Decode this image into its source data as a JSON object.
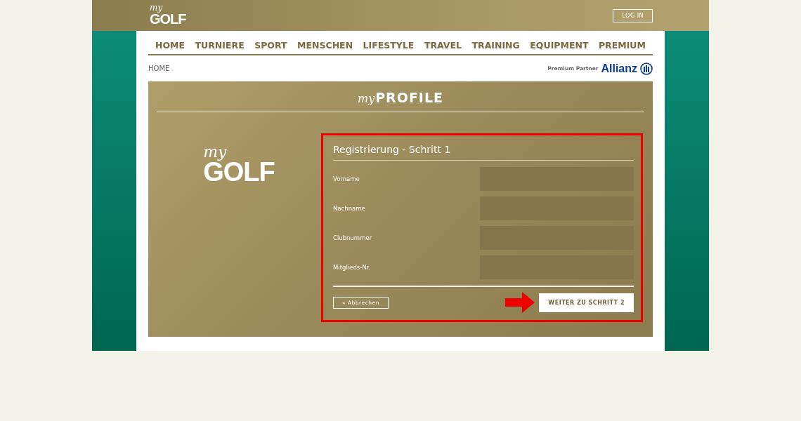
{
  "header": {
    "logo": {
      "script": "my",
      "word": "GOLF"
    },
    "login_button": "LOG IN"
  },
  "nav": {
    "items": [
      {
        "label": "HOME"
      },
      {
        "label": "TURNIERE"
      },
      {
        "label": "SPORT"
      },
      {
        "label": "MENSCHEN"
      },
      {
        "label": "LIFESTYLE"
      },
      {
        "label": "TRAVEL"
      },
      {
        "label": "TRAINING"
      },
      {
        "label": "EQUIPMENT"
      },
      {
        "label": "PREMIUM"
      }
    ]
  },
  "breadcrumb": "HOME",
  "partner": {
    "label": "Premium Partner",
    "brand": "Allianz"
  },
  "profile": {
    "title_script": "my",
    "title": "PROFILE",
    "logo": {
      "script": "my",
      "word": "GOLF"
    },
    "form": {
      "title": "Registrierung - Schritt 1",
      "fields": [
        {
          "label": "Vorname"
        },
        {
          "label": "Nachname"
        },
        {
          "label": "Clubnummer"
        },
        {
          "label": "Mitglieds-Nr."
        }
      ],
      "cancel_button": "« Abbrechen",
      "next_button": "WEITER ZU SCHRITT 2"
    }
  }
}
